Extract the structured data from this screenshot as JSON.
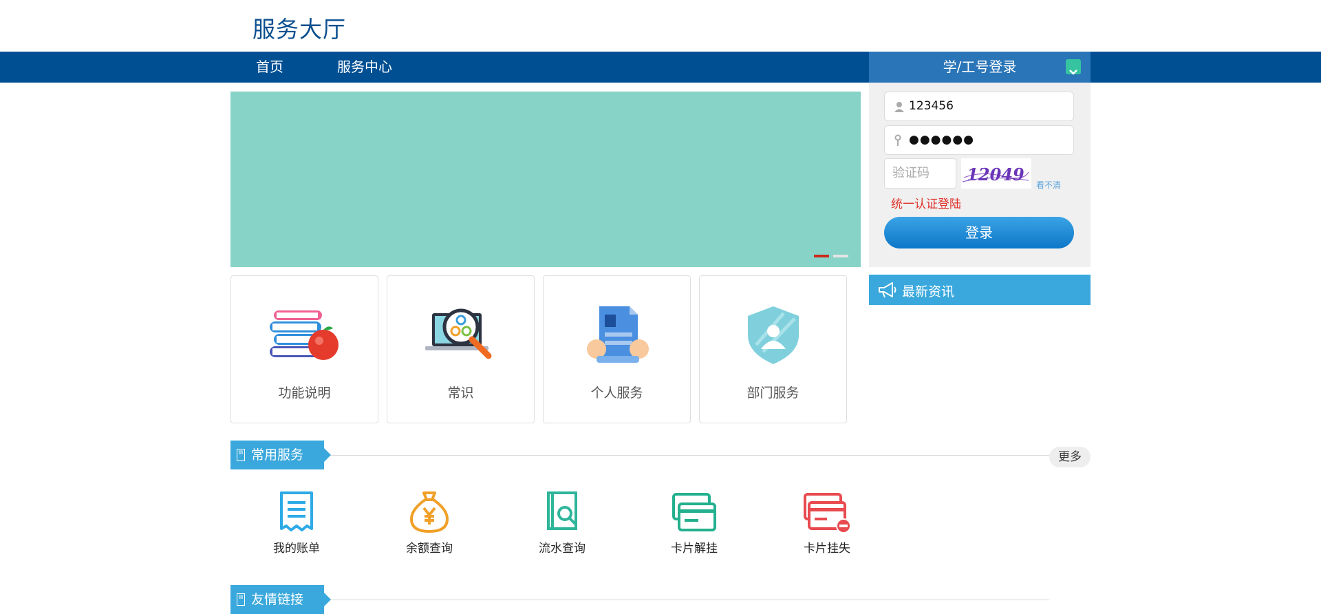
{
  "header": {
    "title": "服务大厅"
  },
  "nav": {
    "items": [
      {
        "label": "首页"
      },
      {
        "label": "服务中心"
      }
    ]
  },
  "login": {
    "tab_label": "学/工号登录",
    "username": "123456",
    "password": "●●●●●●",
    "captcha_placeholder": "验证码",
    "captcha_image_text": "12049",
    "refresh_link": "看不清",
    "sso_link": "统一认证登陆",
    "submit_label": "登录"
  },
  "news": {
    "title": "最新资讯"
  },
  "banner": {
    "slides": 2,
    "active": 1,
    "color": "#87d3c7"
  },
  "cards": [
    {
      "label": "功能说明",
      "icon": "books-apple-icon"
    },
    {
      "label": "常识",
      "icon": "magnifier-laptop-icon"
    },
    {
      "label": "个人服务",
      "icon": "document-hands-icon"
    },
    {
      "label": "部门服务",
      "icon": "shield-user-icon"
    }
  ],
  "common_services": {
    "title": "常用服务",
    "more_label": "更多",
    "items": [
      {
        "label": "我的账单",
        "icon": "bill-icon",
        "color": "#2eaae6"
      },
      {
        "label": "余额查询",
        "icon": "money-bag-icon",
        "color": "#f0a028"
      },
      {
        "label": "流水查询",
        "icon": "ledger-search-icon",
        "color": "#2fb59a"
      },
      {
        "label": "卡片解挂",
        "icon": "cards-icon",
        "color": "#23b08e"
      },
      {
        "label": "卡片挂失",
        "icon": "card-lost-icon",
        "color": "#e84a4f"
      }
    ]
  },
  "links": {
    "title": "友情链接"
  },
  "colors": {
    "nav_bg": "#004f93",
    "accent": "#3aa8dc",
    "title": "#0a4f8f"
  }
}
